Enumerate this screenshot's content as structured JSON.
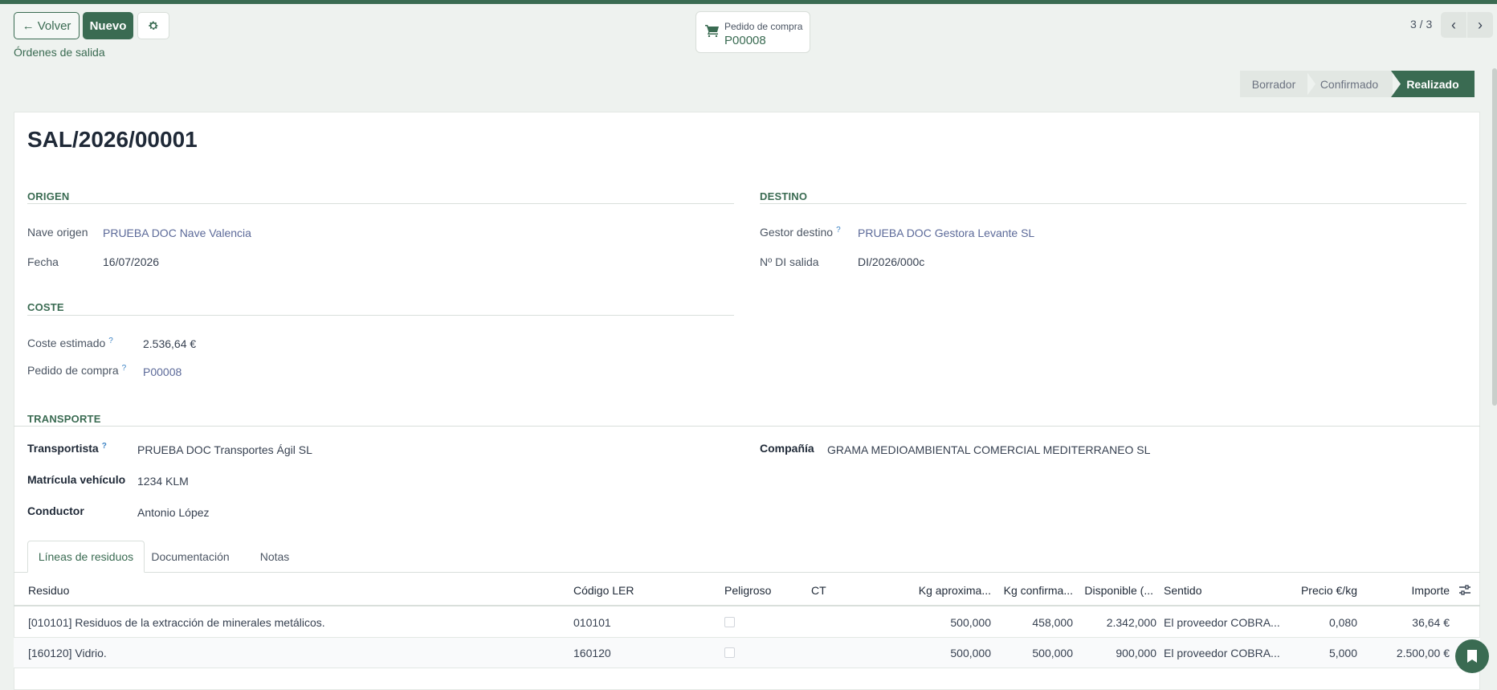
{
  "toolbar": {
    "back_label": "← Volver",
    "new_label": "Nuevo",
    "settings_icon": "gear-icon"
  },
  "breadcrumb": "Órdenes de salida",
  "smart_button": {
    "icon": "cart-icon",
    "label": "Pedido de compra",
    "value": "P00008"
  },
  "pager": {
    "text": "3 / 3"
  },
  "status": {
    "steps": [
      "Borrador",
      "Confirmado",
      "Realizado"
    ],
    "current": "Realizado"
  },
  "record": {
    "title": "SAL/2026/00001"
  },
  "origen": {
    "title": "ORIGEN",
    "nave_label": "Nave origen",
    "nave_value": "PRUEBA DOC Nave Valencia",
    "fecha_label": "Fecha",
    "fecha_value": "16/07/2026"
  },
  "destino": {
    "title": "DESTINO",
    "gestor_label": "Gestor destino",
    "gestor_value": "PRUEBA DOC Gestora Levante SL",
    "di_label": "Nº DI salida",
    "di_value": "DI/2026/000c"
  },
  "coste": {
    "title": "COSTE",
    "estimado_label": "Coste estimado",
    "estimado_value": "2.536,64 €",
    "pedido_label": "Pedido de compra",
    "pedido_value": "P00008"
  },
  "transporte": {
    "title": "TRANSPORTE",
    "transportista_label": "Transportista",
    "transportista_value": "PRUEBA DOC Transportes Ágil SL",
    "matricula_label": "Matrícula vehículo",
    "matricula_value": "1234 KLM",
    "conductor_label": "Conductor",
    "conductor_value": "Antonio López",
    "compania_label": "Compañía",
    "compania_value": "GRAMA MEDIOAMBIENTAL COMERCIAL MEDITERRANEO SL"
  },
  "help_mark": "?",
  "tabs": [
    "Líneas de residuos",
    "Documentación",
    "Notas"
  ],
  "table": {
    "headers": [
      "Residuo",
      "Código LER",
      "Peligroso",
      "CT",
      "Kg aproxima...",
      "Kg confirma...",
      "Disponible (...",
      "Sentido",
      "Precio €/kg",
      "Importe"
    ],
    "rows": [
      {
        "residuo": "[010101] Residuos de la extracción de minerales metálicos.",
        "ler": "010101",
        "peligroso": false,
        "ct": "",
        "kg_aprox": "500,000",
        "kg_conf": "458,000",
        "disponible": "2.342,000",
        "sentido": "El proveedor COBRA...",
        "precio": "0,080",
        "importe": "36,64 €"
      },
      {
        "residuo": "[160120] Vidrio.",
        "ler": "160120",
        "peligroso": false,
        "ct": "",
        "kg_aprox": "500,000",
        "kg_conf": "500,000",
        "disponible": "900,000",
        "sentido": "El proveedor COBRA...",
        "precio": "5,000",
        "importe": "2.500,00 €"
      }
    ]
  },
  "colors": {
    "brand": "#3a6b52",
    "link": "#5c6a99",
    "help": "#3b82c4"
  }
}
